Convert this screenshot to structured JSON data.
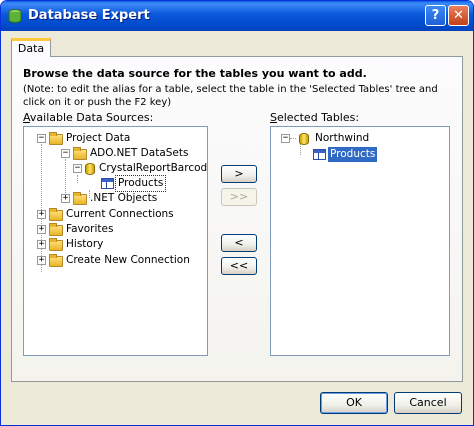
{
  "window": {
    "title": "Database Expert",
    "help_label": "?",
    "close_label": "✕"
  },
  "tabs": [
    {
      "label": "Data"
    }
  ],
  "content": {
    "heading": "Browse the data source for the tables you want to add.",
    "note": "(Note: to edit the alias for a table, select the table in the 'Selected Tables' tree and click on it or push the F2 key)"
  },
  "available": {
    "label_prefix": "A",
    "label_rest": "vailable Data Sources:",
    "tree": [
      {
        "label": "Project Data",
        "expander": "−",
        "icon": "folder"
      },
      {
        "label": "ADO.NET DataSets",
        "expander": "−",
        "icon": "folder"
      },
      {
        "label": "CrystalReportBarcodeD",
        "expander": "−",
        "icon": "database"
      },
      {
        "label": "Products",
        "expander": "",
        "icon": "table"
      },
      {
        "label": ".NET Objects",
        "expander": "+",
        "icon": "folder"
      },
      {
        "label": "Current Connections",
        "expander": "+",
        "icon": "folder"
      },
      {
        "label": "Favorites",
        "expander": "+",
        "icon": "folder"
      },
      {
        "label": "History",
        "expander": "+",
        "icon": "folder"
      },
      {
        "label": "Create New Connection",
        "expander": "+",
        "icon": "folder"
      }
    ]
  },
  "selected": {
    "label_prefix": "S",
    "label_rest": "elected Tables:",
    "tree": [
      {
        "label": "Northwind",
        "expander": "−",
        "icon": "database"
      },
      {
        "label": "Products",
        "expander": "",
        "icon": "table"
      }
    ]
  },
  "transfer_buttons": {
    "add": ">",
    "add_all": ">>",
    "remove": "<",
    "remove_all": "<<"
  },
  "footer": {
    "ok": "OK",
    "cancel": "Cancel"
  }
}
